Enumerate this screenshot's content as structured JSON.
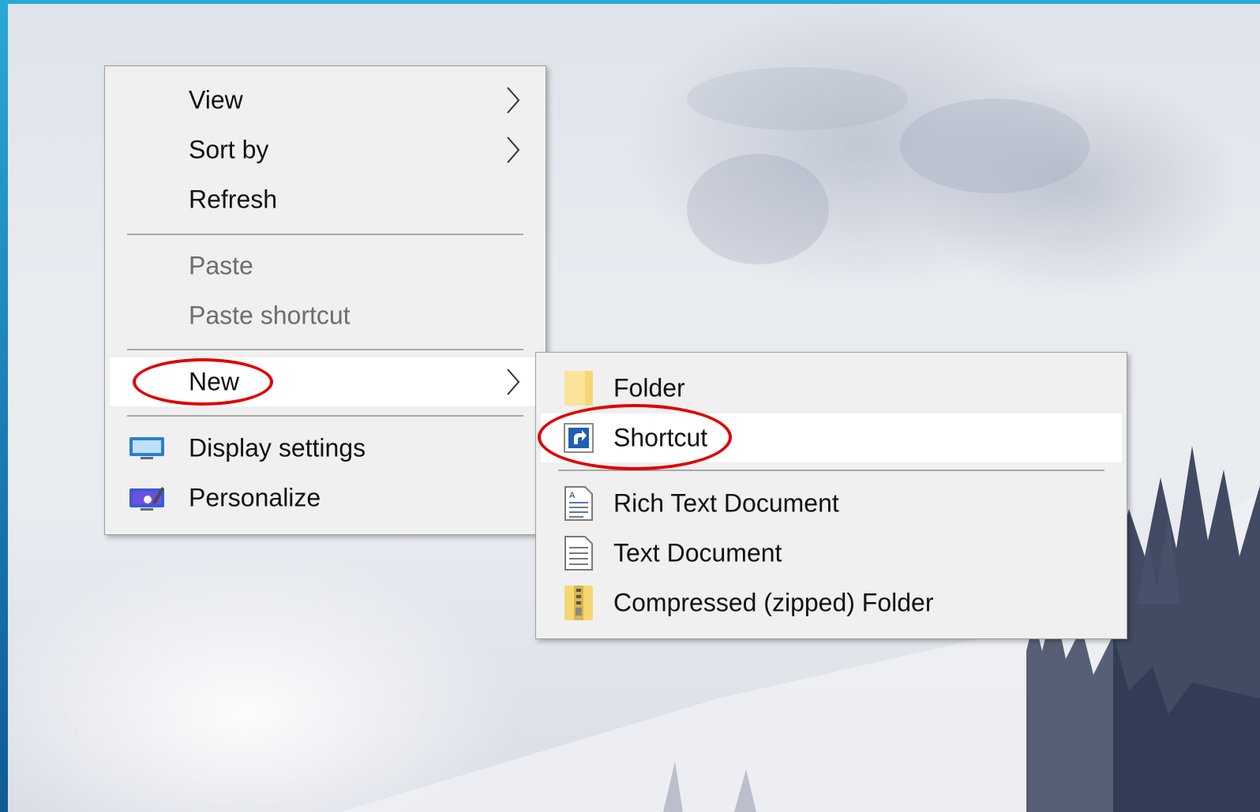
{
  "context_menu": {
    "items": [
      {
        "label": "View",
        "has_submenu": true
      },
      {
        "label": "Sort by",
        "has_submenu": true
      },
      {
        "label": "Refresh"
      }
    ],
    "clipboard_items": [
      {
        "label": "Paste",
        "disabled": true
      },
      {
        "label": "Paste shortcut",
        "disabled": true
      }
    ],
    "new_item": {
      "label": "New",
      "has_submenu": true,
      "highlighted": true
    },
    "settings_items": [
      {
        "label": "Display settings",
        "icon": "display-settings-icon"
      },
      {
        "label": "Personalize",
        "icon": "personalize-icon"
      }
    ]
  },
  "new_submenu": {
    "items": [
      {
        "label": "Folder",
        "icon": "folder-icon"
      },
      {
        "label": "Shortcut",
        "icon": "shortcut-icon",
        "highlighted": true
      },
      {
        "label": "Rich Text Document",
        "icon": "rich-text-document-icon"
      },
      {
        "label": "Text Document",
        "icon": "text-document-icon"
      },
      {
        "label": "Compressed (zipped) Folder",
        "icon": "zipped-folder-icon"
      }
    ]
  },
  "annotations": {
    "color": "#e00000"
  },
  "colors": {
    "menu_bg": "#f0f0f0",
    "hover_bg": "#ffffff",
    "disabled_text": "#6d6d6d"
  }
}
